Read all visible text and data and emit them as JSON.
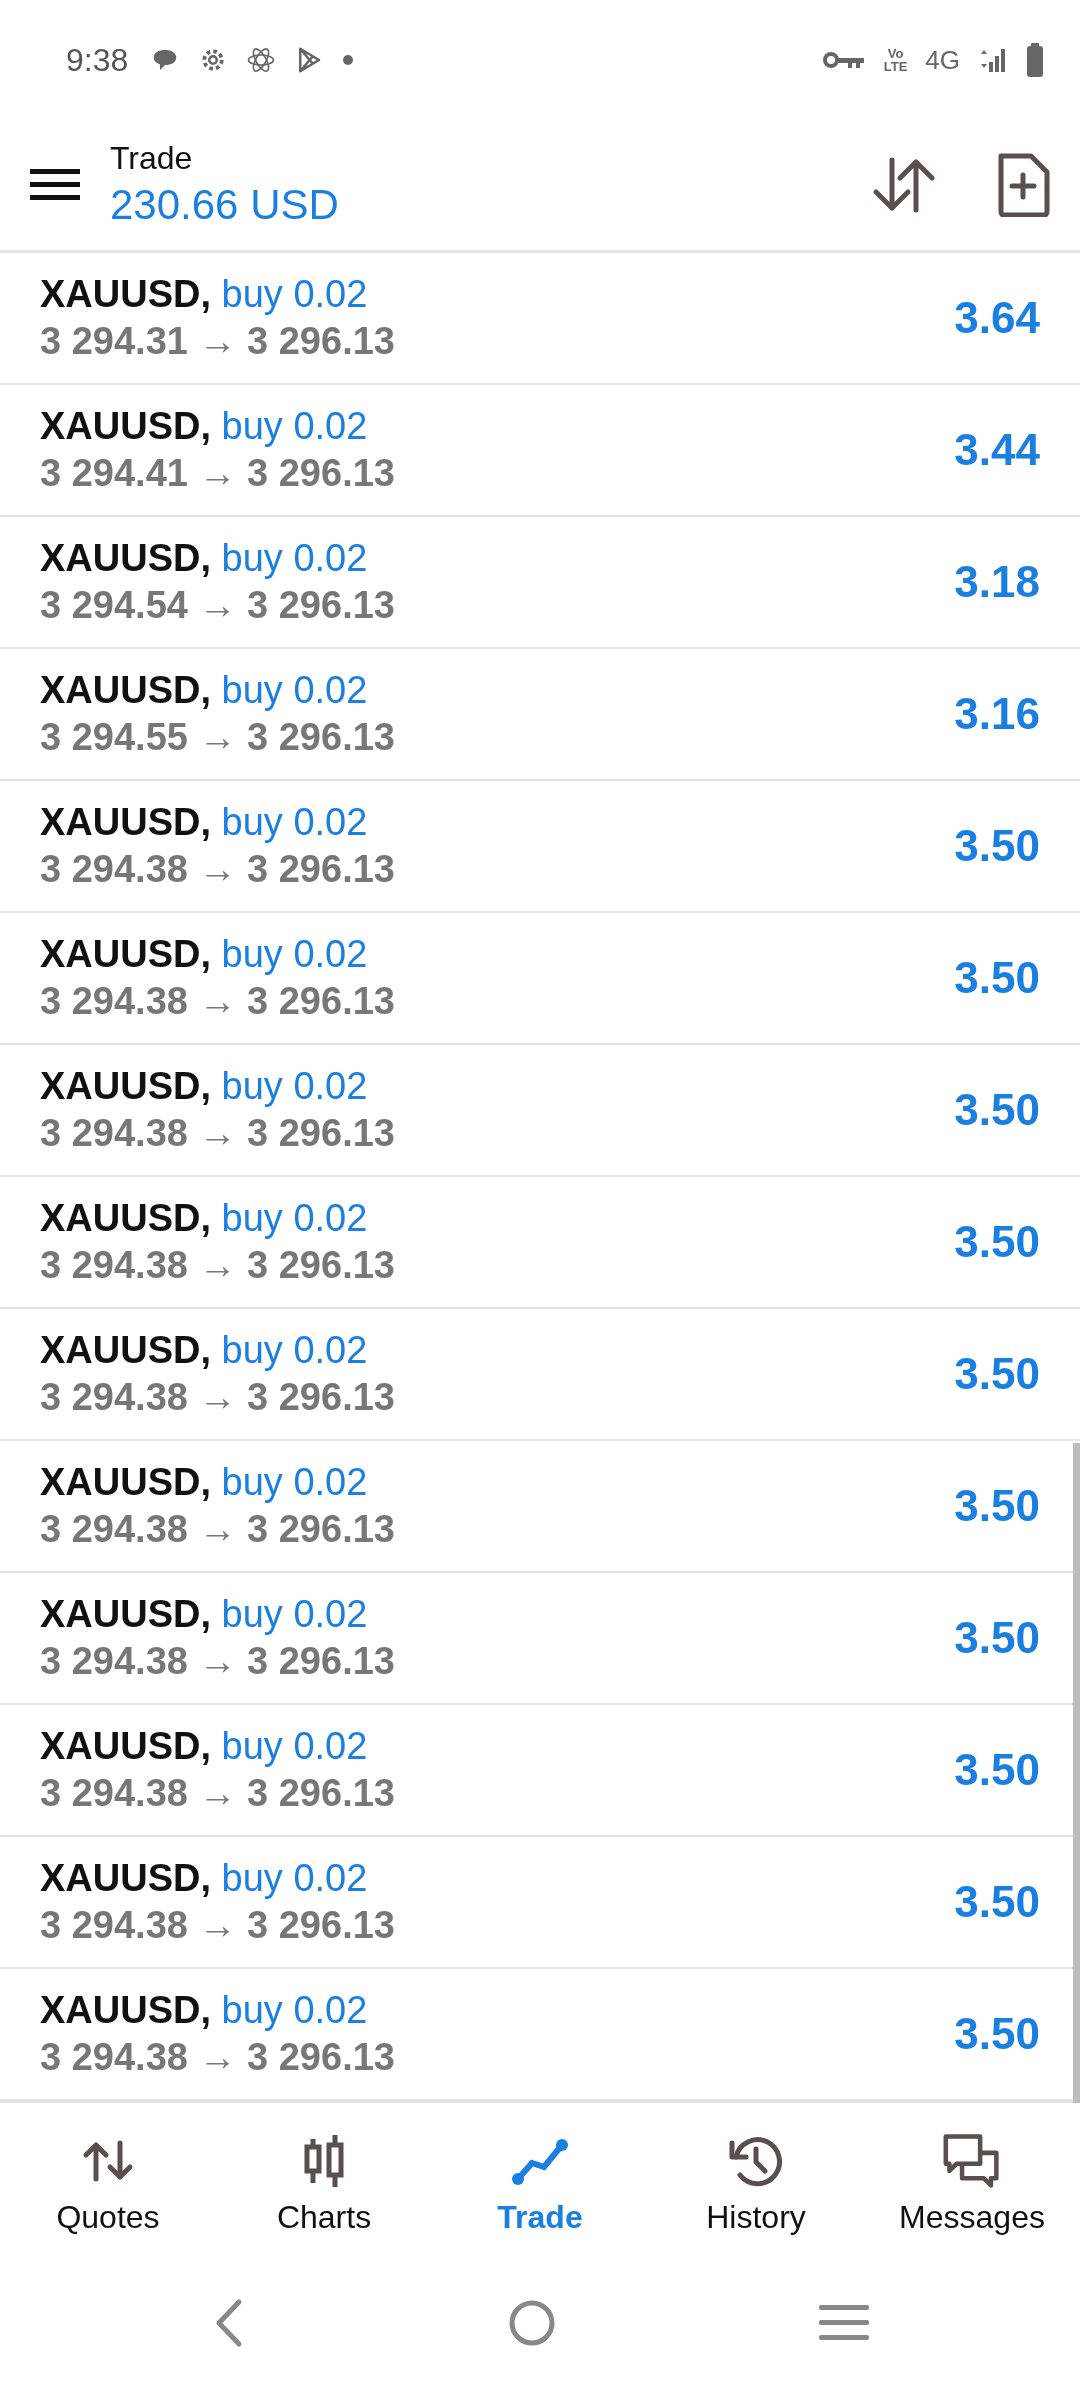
{
  "status_bar": {
    "time": "9:38",
    "volte_top": "Vo",
    "volte_bottom": "LTE",
    "network": "4G"
  },
  "header": {
    "title": "Trade",
    "balance": "230.66 USD"
  },
  "positions": [
    {
      "symbol": "XAUUSD,",
      "side": "buy 0.02",
      "prices": "3 294.31 → 3 296.13",
      "profit": "3.64"
    },
    {
      "symbol": "XAUUSD,",
      "side": "buy 0.02",
      "prices": "3 294.41 → 3 296.13",
      "profit": "3.44"
    },
    {
      "symbol": "XAUUSD,",
      "side": "buy 0.02",
      "prices": "3 294.54 → 3 296.13",
      "profit": "3.18"
    },
    {
      "symbol": "XAUUSD,",
      "side": "buy 0.02",
      "prices": "3 294.55 → 3 296.13",
      "profit": "3.16"
    },
    {
      "symbol": "XAUUSD,",
      "side": "buy 0.02",
      "prices": "3 294.38 → 3 296.13",
      "profit": "3.50"
    },
    {
      "symbol": "XAUUSD,",
      "side": "buy 0.02",
      "prices": "3 294.38 → 3 296.13",
      "profit": "3.50"
    },
    {
      "symbol": "XAUUSD,",
      "side": "buy 0.02",
      "prices": "3 294.38 → 3 296.13",
      "profit": "3.50"
    },
    {
      "symbol": "XAUUSD,",
      "side": "buy 0.02",
      "prices": "3 294.38 → 3 296.13",
      "profit": "3.50"
    },
    {
      "symbol": "XAUUSD,",
      "side": "buy 0.02",
      "prices": "3 294.38 → 3 296.13",
      "profit": "3.50"
    },
    {
      "symbol": "XAUUSD,",
      "side": "buy 0.02",
      "prices": "3 294.38 → 3 296.13",
      "profit": "3.50"
    },
    {
      "symbol": "XAUUSD,",
      "side": "buy 0.02",
      "prices": "3 294.38 → 3 296.13",
      "profit": "3.50"
    },
    {
      "symbol": "XAUUSD,",
      "side": "buy 0.02",
      "prices": "3 294.38 → 3 296.13",
      "profit": "3.50"
    },
    {
      "symbol": "XAUUSD,",
      "side": "buy 0.02",
      "prices": "3 294.38 → 3 296.13",
      "profit": "3.50"
    },
    {
      "symbol": "XAUUSD,",
      "side": "buy 0.02",
      "prices": "3 294.38 → 3 296.13",
      "profit": "3.50"
    }
  ],
  "bottom_nav": [
    {
      "label": "Quotes",
      "selected": false
    },
    {
      "label": "Charts",
      "selected": false
    },
    {
      "label": "Trade",
      "selected": true
    },
    {
      "label": "History",
      "selected": false
    },
    {
      "label": "Messages",
      "selected": false
    }
  ]
}
